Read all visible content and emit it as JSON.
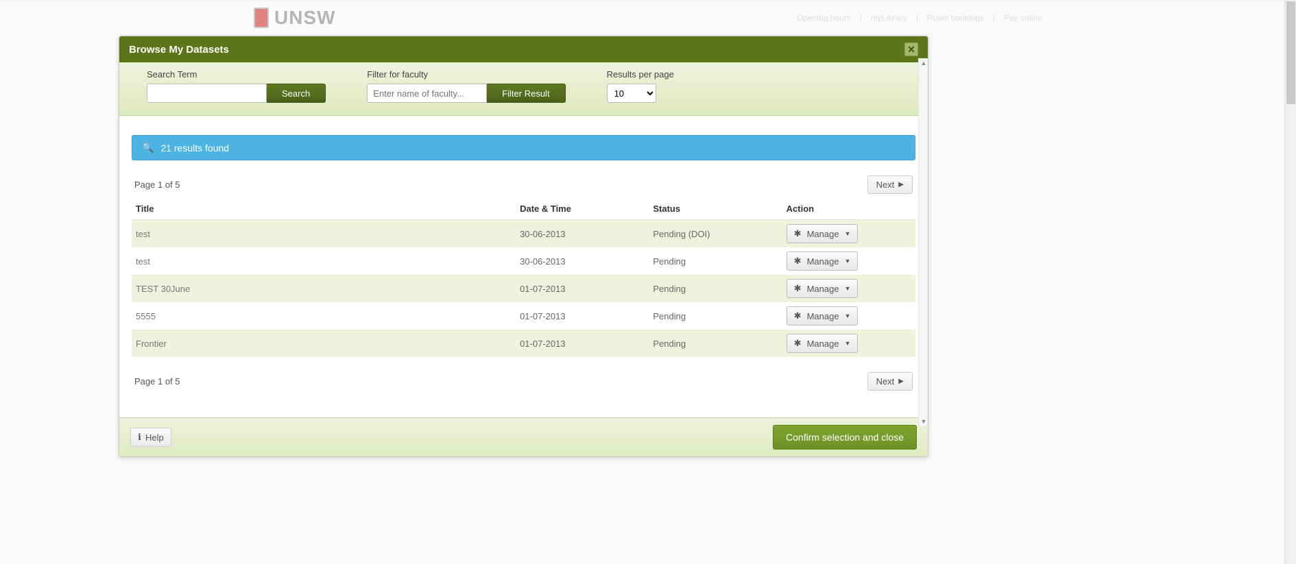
{
  "background": {
    "logo_text": "UNSW",
    "top_links": [
      "Opening hours",
      "myLibrary",
      "Room bookings",
      "Pay online"
    ]
  },
  "modal": {
    "title": "Browse My Datasets",
    "close_glyph": "✕"
  },
  "filters": {
    "search_label": "Search Term",
    "search_value": "",
    "search_button": "Search",
    "faculty_label": "Filter for faculty",
    "faculty_placeholder": "Enter name of faculty...",
    "faculty_value": "",
    "faculty_button": "Filter Result",
    "perpage_label": "Results per page",
    "perpage_value": "10"
  },
  "results": {
    "banner_text": "21 results found",
    "page_text_top": "Page 1 of 5",
    "page_text_bottom": "Page 1 of 5",
    "next_label": "Next",
    "columns": {
      "title": "Title",
      "date": "Date & Time",
      "status": "Status",
      "action": "Action"
    },
    "manage_label": "Manage",
    "rows": [
      {
        "title": "test",
        "date": "30-06-2013",
        "status": "Pending (DOI)"
      },
      {
        "title": "test",
        "date": "30-06-2013",
        "status": "Pending"
      },
      {
        "title": "TEST 30June",
        "date": "01-07-2013",
        "status": "Pending"
      },
      {
        "title": "5555",
        "date": "01-07-2013",
        "status": "Pending"
      },
      {
        "title": "Frontier",
        "date": "01-07-2013",
        "status": "Pending"
      }
    ]
  },
  "footer": {
    "help_label": "Help",
    "confirm_label": "Confirm selection and close"
  }
}
